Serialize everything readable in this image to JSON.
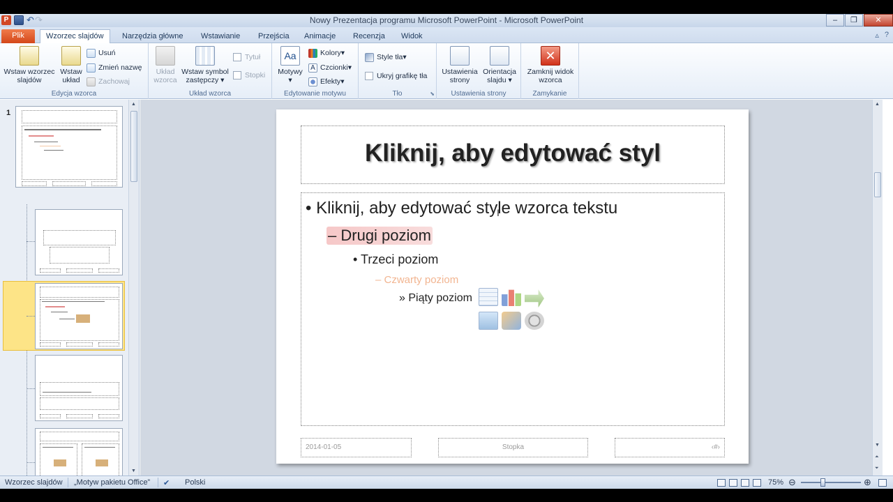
{
  "window": {
    "title": "Nowy Prezentacja programu Microsoft PowerPoint  -  Microsoft PowerPoint",
    "app_icon": "P"
  },
  "tabs": [
    {
      "label": "Plik"
    },
    {
      "label": "Wzorzec slajdów"
    },
    {
      "label": "Narzędzia główne"
    },
    {
      "label": "Wstawianie"
    },
    {
      "label": "Przejścia"
    },
    {
      "label": "Animacje"
    },
    {
      "label": "Recenzja"
    },
    {
      "label": "Widok"
    }
  ],
  "ribbon": {
    "edit_master": {
      "label": "Edycja wzorca",
      "insert_master": "Wstaw wzorzec slajdów",
      "insert_layout": "Wstaw układ",
      "delete": "Usuń",
      "rename": "Zmień nazwę",
      "preserve": "Zachowaj"
    },
    "master_layout": {
      "label": "Układ wzorca",
      "master_layout_btn": "Układ wzorca",
      "insert_placeholder": "Wstaw symbol zastępczy",
      "title_chk": "Tytuł",
      "footers_chk": "Stopki"
    },
    "edit_theme": {
      "label": "Edytowanie motywu",
      "themes": "Motywy",
      "colors": "Kolory",
      "fonts": "Czcionki",
      "effects": "Efekty"
    },
    "background": {
      "label": "Tło",
      "bg_styles": "Style tła",
      "hide_bg": "Ukryj grafikę tła"
    },
    "page_setup": {
      "label": "Ustawienia strony",
      "page_setup_btn": "Ustawienia strony",
      "orientation": "Orientacja slajdu"
    },
    "close": {
      "label": "Zamykanie",
      "close_btn": "Zamknij widok wzorca"
    }
  },
  "pane": {
    "first_thumb_number": "1"
  },
  "slide": {
    "title": "Kliknij, aby edytować styl",
    "levels": [
      "Kliknij, aby edytować style wzorca tekstu",
      "Drugi poziom",
      "Trzeci poziom",
      "Czwarty poziom",
      "Piąty poziom"
    ],
    "bullets": [
      "•",
      "–",
      "•",
      "–",
      "»"
    ],
    "footer_date": "2014-01-05",
    "footer_text": "Stopka",
    "footer_number": "‹#›"
  },
  "status": {
    "view": "Wzorzec slajdów",
    "theme": "„Motyw pakietu Office”",
    "language": "Polski",
    "zoom": "75%"
  },
  "colors": {
    "file_tab": "#d4471a",
    "level2_highlight": "#f6c8c8",
    "level4_text": "#f2b591",
    "selected_thumb": "#fde487"
  }
}
